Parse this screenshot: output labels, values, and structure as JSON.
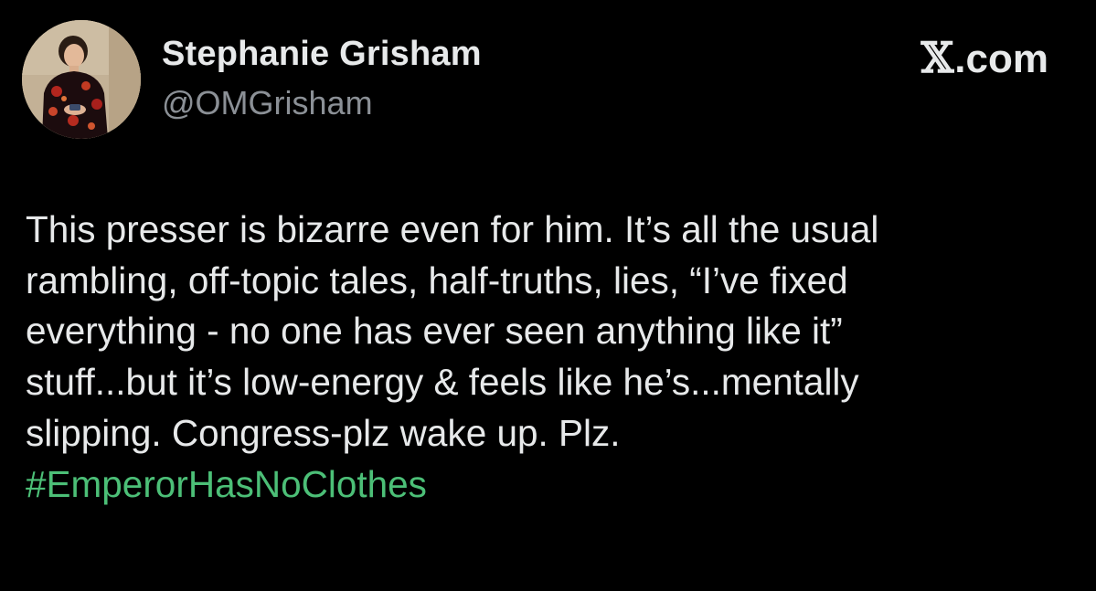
{
  "author": {
    "display_name": "Stephanie Grisham",
    "handle": "@OMGrisham"
  },
  "brand": {
    "label": ".com",
    "x_glyph": "𝕏"
  },
  "tweet": {
    "lines": [
      "This presser is bizarre even for him. It’s all the usual",
      "rambling, off-topic tales, half-truths, lies, “I’ve fixed",
      "everything - no one has ever seen anything like it”",
      "stuff...but it’s low-energy & feels like he’s...mentally",
      "slipping. Congress-plz wake up. Plz."
    ],
    "hashtag": "#EmperorHasNoClothes"
  },
  "colors": {
    "background": "#000000",
    "text": "#e7e9ea",
    "handle": "#8b9096",
    "hashtag": "#4cbf77"
  },
  "icons": {
    "avatar": "profile-photo"
  }
}
